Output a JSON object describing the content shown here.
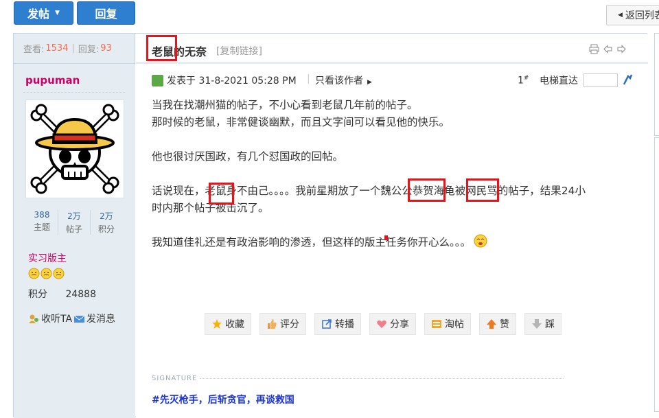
{
  "topbar": {
    "post_label": "发帖",
    "reply_label": "回复",
    "back_label": "返回列表"
  },
  "sidebar": {
    "views_label": "查看:",
    "views": "1534",
    "replies_label": "回复:",
    "replies": "93",
    "username": "pupuman",
    "stats": [
      {
        "value": "388",
        "label": "主题"
      },
      {
        "value": "2万",
        "label": "帖子"
      },
      {
        "value": "2万",
        "label": "积分"
      }
    ],
    "rank": "实习版主",
    "credits_label": "积分",
    "credits_value": "24888",
    "follow_label": "收听TA",
    "message_label": "发消息"
  },
  "thread": {
    "title": "老鼠的无奈",
    "copy_link": "[复制链接]",
    "posted_at": "发表于 31-8-2021 05:28 PM",
    "only_author": "只看该作者",
    "floor": "1",
    "floor_mark": "#",
    "jump_label": "电梯直达"
  },
  "post": {
    "lines": [
      "当我在找潮州猫的帖子，不小心看到老鼠几年前的帖子。",
      "那时候的老鼠，非常健谈幽默，而且文字间可以看见他的快乐。",
      "",
      "他也很讨厌国政，有几个怼国政的回帖。",
      "",
      "话说现在，老鼠身不由己。。。。我前星期放了一个魏公公恭贺海龟被网民骂的帖子，结果24小",
      "时内那个帖子被击沉了。",
      "",
      "我知道佳礼还是有政治影响的渗透，但这样的版主任务你开心么。。。"
    ]
  },
  "actions": [
    {
      "label": "收藏",
      "icon": "star-icon"
    },
    {
      "label": "评分",
      "icon": "thumb-icon"
    },
    {
      "label": "转播",
      "icon": "share-arrow-icon"
    },
    {
      "label": "分享",
      "icon": "heart-icon"
    },
    {
      "label": "淘帖",
      "icon": "folder-icon"
    },
    {
      "label": "赞",
      "icon": "arrow-up-icon"
    },
    {
      "label": "踩",
      "icon": "arrow-down-icon"
    }
  ],
  "signature": {
    "heading": "SIGNATURE",
    "text": "#先灭枪手，后斩贪官，再谈救国"
  },
  "colors": {
    "button_blue": "#2f7fd0",
    "sidebar_bg": "#e5edf2",
    "username": "#cc0066",
    "highlight_red": "#e8121a",
    "signature_blue": "#1a33cc"
  }
}
